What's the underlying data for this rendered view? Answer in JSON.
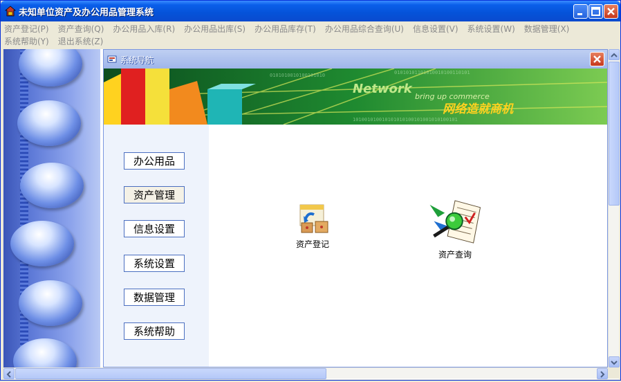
{
  "window": {
    "title": "未知单位资产及办公用品管理系统"
  },
  "menu": {
    "row1": [
      "资产登记(P)",
      "资产查询(Q)",
      "办公用品入库(R)",
      "办公用品出库(S)",
      "办公用品库存(T)",
      "办公用品综合查询(U)",
      "信息设置(V)",
      "系统设置(W)",
      "数据管理(X)"
    ],
    "row2": [
      "系统帮助(Y)",
      "退出系统(Z)"
    ]
  },
  "nav_window": {
    "title": "系统导航",
    "banner": {
      "word1": "Network",
      "word2": "bring up commerce",
      "slogan": "网络造就商机"
    },
    "buttons": [
      "办公用品",
      "资产管理",
      "信息设置",
      "系统设置",
      "数据管理",
      "系统帮助"
    ],
    "active_button": "资产管理",
    "features": [
      {
        "label": "资产登记",
        "icon": "asset-register-icon"
      },
      {
        "label": "资产查询",
        "icon": "asset-search-icon"
      }
    ]
  },
  "colors": {
    "titlebar": "#0A5FEA",
    "banner_green": "#1E8B2E",
    "nav_panel": "#EEF3FC"
  }
}
